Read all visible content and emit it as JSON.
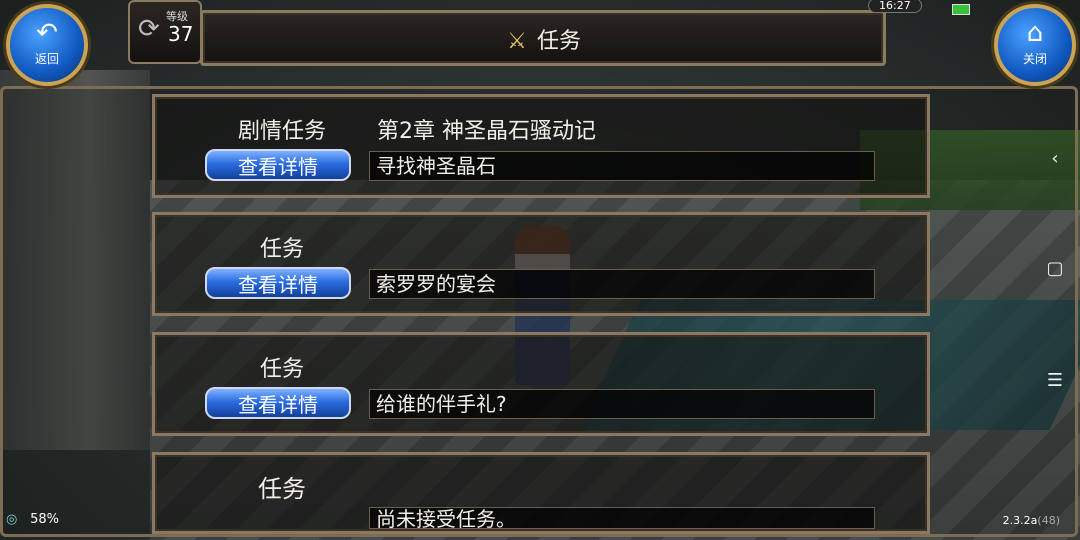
{
  "header": {
    "title": "任务",
    "level_label": "等级",
    "level_value": "37"
  },
  "buttons": {
    "back_label": "返回",
    "close_label": "关闭"
  },
  "status_bar": {
    "time": "16:27"
  },
  "quests": [
    {
      "type": "剧情任务",
      "chapter": "第2章 神圣晶石骚动记",
      "button_label": "查看详情",
      "description": "寻找神圣晶石"
    },
    {
      "type": "任务",
      "chapter": "",
      "button_label": "查看详情",
      "description": "索罗罗的宴会"
    },
    {
      "type": "任务",
      "chapter": "",
      "button_label": "查看详情",
      "description": "给谁的伴手礼?"
    },
    {
      "type": "任务",
      "chapter": "",
      "button_label": "",
      "description": "尚未接受任务。"
    }
  ],
  "footer": {
    "ping_percent": "58%",
    "version": "2.3.2a",
    "version_sub": "(48)"
  },
  "side_nav": {
    "back_glyph": "‹",
    "home_glyph": "▢",
    "menu_glyph": "☰"
  },
  "icons": {
    "back": "back-arrow-icon",
    "close": "home-icon",
    "quest": "quest-swords-icon"
  }
}
